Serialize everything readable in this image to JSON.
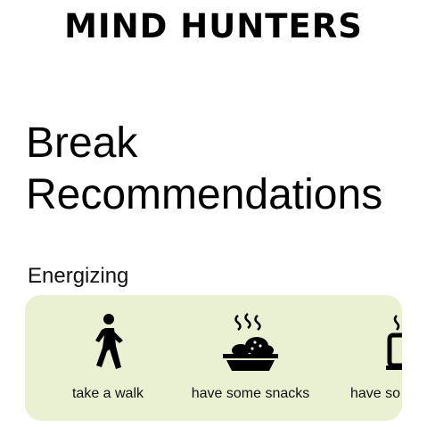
{
  "app": {
    "brand": "MIND HUNTERS"
  },
  "page": {
    "title_line1": "Break",
    "title_line2": "Recommendations"
  },
  "section": {
    "label": "Energizing"
  },
  "recommendations": [
    {
      "label": "take a walk",
      "icon": "walking-person-icon"
    },
    {
      "label": "have some snacks",
      "icon": "snack-bowl-icon"
    },
    {
      "label": "have so",
      "icon": "coffee-cup-icon"
    }
  ],
  "colors": {
    "card_bg": "#e9f1d2",
    "text": "#111111"
  }
}
